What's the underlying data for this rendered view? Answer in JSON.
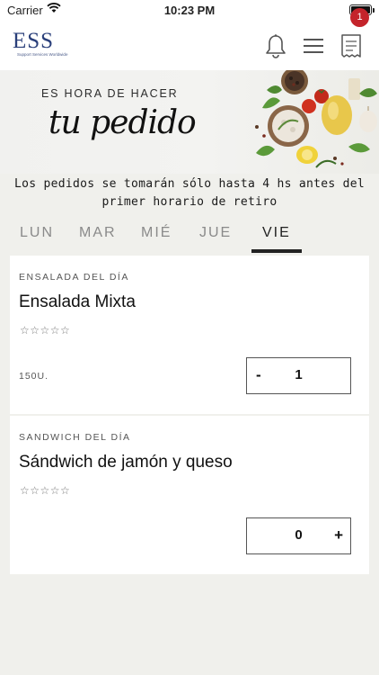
{
  "status_bar": {
    "carrier": "Carrier",
    "time": "10:23 PM"
  },
  "header": {
    "logo_text": "ESS",
    "logo_subtitle": "Support Services Worldwide",
    "cart_badge": "1"
  },
  "banner": {
    "kicker": "ES HORA DE HACER",
    "title": "tu pedido"
  },
  "notice": {
    "line1": "Los pedidos se tomarán sólo hasta 4 hs antes del",
    "line2": "primer horario de retiro"
  },
  "tabs": [
    {
      "label": "LUN"
    },
    {
      "label": "MAR"
    },
    {
      "label": "MIÉ"
    },
    {
      "label": "JUE"
    },
    {
      "label": "VIE",
      "active": true
    }
  ],
  "items": [
    {
      "category": "ENSALADA DEL DÍA",
      "name": "Ensalada Mixta",
      "rating": "☆☆☆☆☆",
      "price": "150U.",
      "minus_label": "-",
      "quantity": "1"
    },
    {
      "category": "SANDWICH DEL DÍA",
      "name": "Sándwich de jamón y queso",
      "rating": "☆☆☆☆☆",
      "quantity": "0",
      "plus_label": "+"
    }
  ],
  "colors": {
    "background": "#f0f0ec",
    "brand": "#2a3f7a",
    "badge": "#c4242b",
    "active_tab": "#222222",
    "inactive_tab": "#8a8a8a"
  }
}
